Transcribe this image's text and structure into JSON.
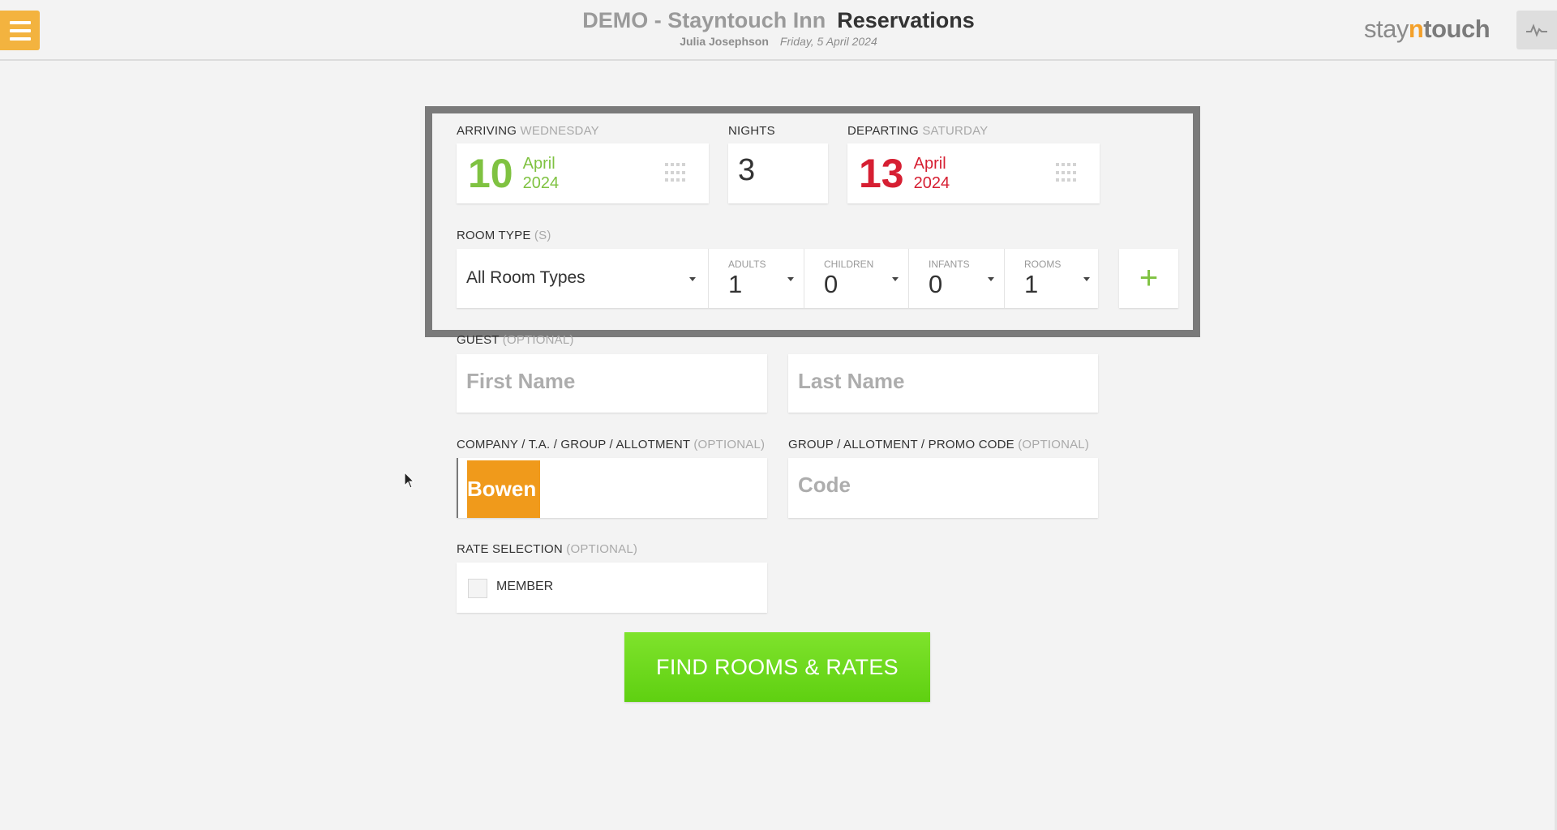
{
  "header": {
    "hotel_name": "DEMO - Stayntouch Inn",
    "section": "Reservations",
    "user": "Julia Josephson",
    "date": "Friday, 5 April 2024",
    "logo": {
      "pre": "stay",
      "n": "n",
      "post": "touch"
    }
  },
  "arriving": {
    "label": "ARRIVING",
    "weekday": "WEDNESDAY",
    "day": "10",
    "month": "April",
    "year": "2024"
  },
  "nights": {
    "label": "NIGHTS",
    "value": "3"
  },
  "departing": {
    "label": "DEPARTING",
    "weekday": "SATURDAY",
    "day": "13",
    "month": "April",
    "year": "2024"
  },
  "room_type": {
    "label": "ROOM TYPE",
    "suffix": "(S)",
    "selected": "All Room Types"
  },
  "occupancy": {
    "adults": {
      "label": "ADULTS",
      "value": "1"
    },
    "children": {
      "label": "CHILDREN",
      "value": "0"
    },
    "infants": {
      "label": "INFANTS",
      "value": "0"
    },
    "rooms": {
      "label": "ROOMS",
      "value": "1"
    }
  },
  "add_label": "+",
  "guest": {
    "label": "GUEST",
    "optional": "(OPTIONAL)",
    "first_placeholder": "First Name",
    "last_placeholder": "Last Name"
  },
  "company": {
    "label": "COMPANY / T.A. / GROUP / ALLOTMENT",
    "optional": "(OPTIONAL)",
    "value": "Bowen"
  },
  "promo": {
    "label": "GROUP / ALLOTMENT / PROMO CODE",
    "optional": "(OPTIONAL)",
    "placeholder": "Code"
  },
  "rate": {
    "label": "RATE SELECTION",
    "optional": "(OPTIONAL)",
    "member_label": "MEMBER",
    "member_checked": false
  },
  "find_button": "FIND ROOMS & RATES",
  "colors": {
    "accent_orange": "#f3b33f",
    "arrive_green": "#7fc241",
    "depart_red": "#d61f32",
    "button_green": "#6fd920"
  }
}
